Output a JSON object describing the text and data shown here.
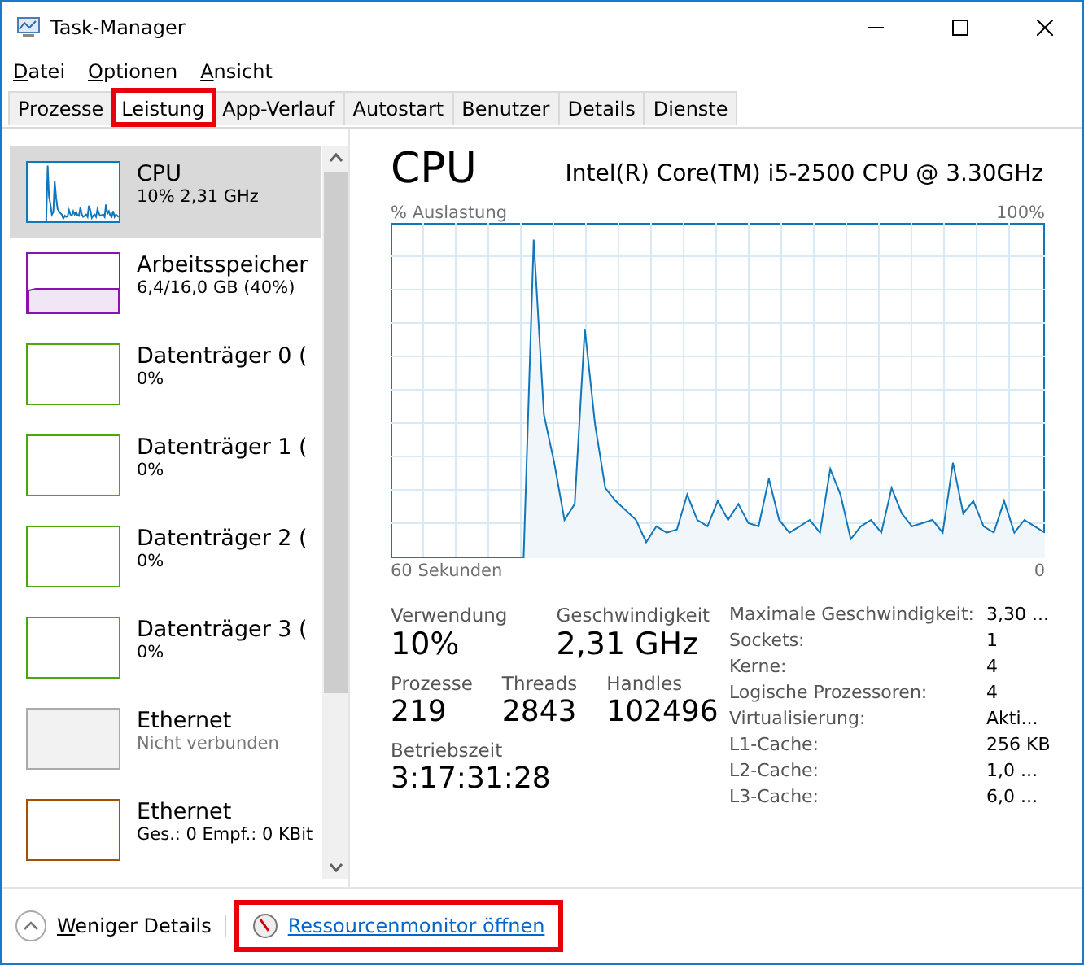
{
  "window": {
    "title": "Task-Manager"
  },
  "menu": [
    "Datei",
    "Optionen",
    "Ansicht"
  ],
  "tabs": [
    {
      "label": "Prozesse",
      "selected": false,
      "highlighted": false
    },
    {
      "label": "Leistung",
      "selected": true,
      "highlighted": true
    },
    {
      "label": "App-Verlauf",
      "selected": false,
      "highlighted": false
    },
    {
      "label": "Autostart",
      "selected": false,
      "highlighted": false
    },
    {
      "label": "Benutzer",
      "selected": false,
      "highlighted": false
    },
    {
      "label": "Details",
      "selected": false,
      "highlighted": false
    },
    {
      "label": "Dienste",
      "selected": false,
      "highlighted": false
    }
  ],
  "sidebar": {
    "items": [
      {
        "title": "CPU",
        "subtitle": "10%  2,31 GHz",
        "selected": true,
        "color": "#1177bb",
        "muted": false
      },
      {
        "title": "Arbeitsspeicher",
        "subtitle": "6,4/16,0 GB (40%)",
        "selected": false,
        "color": "#8b12ae",
        "muted": false
      },
      {
        "title": "Datenträger 0 (",
        "subtitle": "0%",
        "selected": false,
        "color": "#4da60c",
        "muted": false
      },
      {
        "title": "Datenträger 1 (",
        "subtitle": "0%",
        "selected": false,
        "color": "#4da60c",
        "muted": false
      },
      {
        "title": "Datenträger 2 (",
        "subtitle": "0%",
        "selected": false,
        "color": "#4da60c",
        "muted": false
      },
      {
        "title": "Datenträger 3 (",
        "subtitle": "0%",
        "selected": false,
        "color": "#4da60c",
        "muted": false
      },
      {
        "title": "Ethernet",
        "subtitle": "Nicht verbunden",
        "selected": false,
        "color": "#aaaaaa",
        "muted": true
      },
      {
        "title": "Ethernet",
        "subtitle": "Ges.: 0 Empf.: 0 KBit",
        "selected": false,
        "color": "#a74f01",
        "muted": false
      }
    ]
  },
  "detail": {
    "title": "CPU",
    "model": "Intel(R) Core(TM) i5-2500 CPU @ 3.30GHz",
    "graph": {
      "y_label": "% Auslastung",
      "y_max": "100%",
      "x_label": "60 Sekunden",
      "x_end": "0"
    },
    "stats_large": [
      {
        "label": "Verwendung",
        "value": "10%"
      },
      {
        "label": "Geschwindigkeit",
        "value": "2,31 GHz"
      }
    ],
    "stats_mid": [
      {
        "label": "Prozesse",
        "value": "219"
      },
      {
        "label": "Threads",
        "value": "2843"
      },
      {
        "label": "Handles",
        "value": "102496"
      }
    ],
    "stats_uptime": {
      "label": "Betriebszeit",
      "value": "3:17:31:28"
    },
    "properties": [
      {
        "label": "Maximale Geschwindigkeit:",
        "value": "3,30 ..."
      },
      {
        "label": "Sockets:",
        "value": "1"
      },
      {
        "label": "Kerne:",
        "value": "4"
      },
      {
        "label": "Logische Prozessoren:",
        "value": "4"
      },
      {
        "label": "Virtualisierung:",
        "value": "Akti..."
      },
      {
        "label": "L1-Cache:",
        "value": "256 KB"
      },
      {
        "label": "L2-Cache:",
        "value": "1,0 ..."
      },
      {
        "label": "L3-Cache:",
        "value": "6,0 ..."
      }
    ]
  },
  "footer": {
    "details_button": "Weniger Details",
    "link": {
      "label": "Ressourcenmonitor öffnen",
      "highlighted": true
    }
  }
}
